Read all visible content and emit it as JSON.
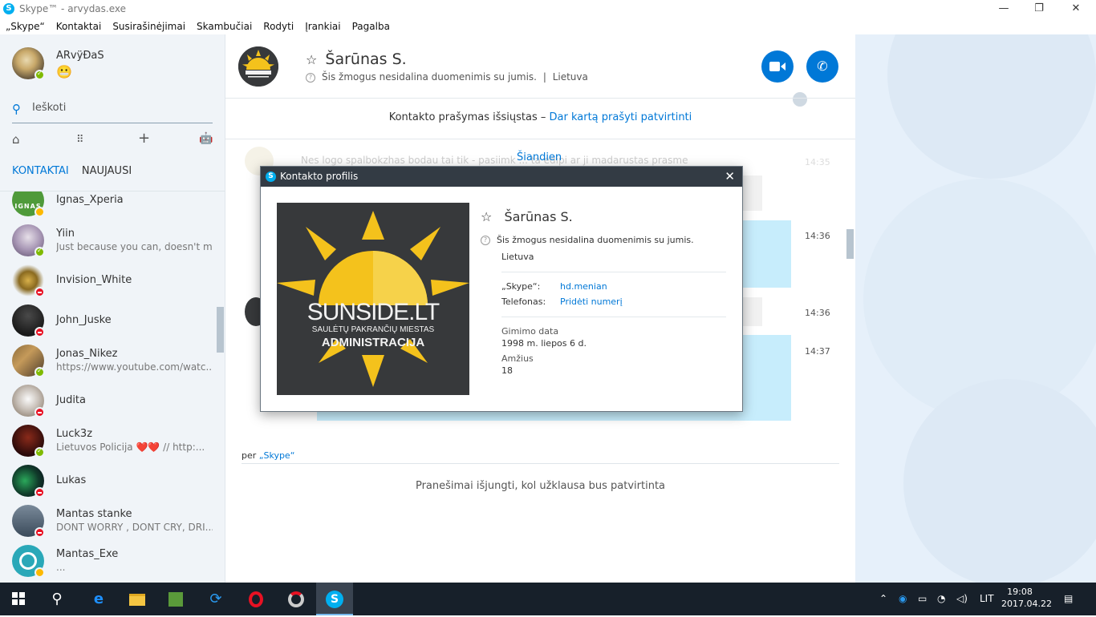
{
  "window": {
    "title": "Skype™ - arvydas.exe",
    "min": "—",
    "restore": "❐",
    "close": "✕"
  },
  "menu": [
    "„Skype“",
    "Kontaktai",
    "Susirašinėjimai",
    "Skambučiai",
    "Rodyti",
    "Įrankiai",
    "Pagalba"
  ],
  "me": {
    "name": "ARvÿÐaS",
    "mood": "😬"
  },
  "search": {
    "placeholder": "Ieškoti"
  },
  "sidebar_tools": {
    "home": "⌂",
    "dialpad": "⠿",
    "add": "+",
    "bot": "🤖"
  },
  "tabs": {
    "contacts": "KONTAKTAI",
    "recent": "NAUJAUSI"
  },
  "contacts": [
    {
      "name": "Ignas_Xperia",
      "message": "",
      "status": "away"
    },
    {
      "name": "Yiin",
      "message": "Just because you can, doesn't me...",
      "status": "online"
    },
    {
      "name": "Invision_White",
      "message": "",
      "status": "dnd"
    },
    {
      "name": "John_Juske",
      "message": "",
      "status": "dnd"
    },
    {
      "name": "Jonas_Nikez",
      "message": "https://www.youtube.com/watc...",
      "status": "online"
    },
    {
      "name": "Judita",
      "message": "",
      "status": "dnd"
    },
    {
      "name": "Luck3z",
      "message": "Lietuvos Policija ❤️❤️ // http:...",
      "status": "online"
    },
    {
      "name": "Lukas",
      "message": "",
      "status": "dnd"
    },
    {
      "name": "Mantas stanke",
      "message": "DONT WORRY , DONT CRY, DRI...",
      "status": "dnd"
    },
    {
      "name": "Mantas_Exe",
      "message": "...",
      "status": "away"
    }
  ],
  "avatar_labels": {
    "ignas": "IGNAS"
  },
  "chat": {
    "contact_name": "Šarūnas S.",
    "subtitle": "Šis žmogus nesidalina duomenimis su jumis.",
    "location_sep": "|",
    "location": "Lietuva",
    "request_text": "Kontakto prašymas išsiųstas –",
    "request_link": "Dar kartą prašyti patvirtinti",
    "today": "Šiandien",
    "times": [
      "14:35",
      "14:36",
      "14:36",
      "14:37"
    ],
    "via_label": "per",
    "via_link": "„Skype“",
    "notice": "Pranešimai išjungti, kol užklausa bus patvirtinta",
    "faded_message": "Nes logo spalbokzhas bodau tai tik - pasiimk ... ta edipi ar ji madarustas prasme"
  },
  "logo": {
    "brand": "SUNSIDE.LT",
    "line1": "SAULĖTŲ PAKRANČIŲ MIESTAS",
    "line2": "ADMINISTRACIJA"
  },
  "dialog": {
    "title": "Kontakto profilis",
    "close": "✕",
    "name": "Šarūnas S.",
    "subtitle": "Šis žmogus nesidalina duomenimis su jumis.",
    "location": "Lietuva",
    "skype_label": "„Skype“:",
    "skype_value": "hd.menian",
    "phone_label": "Telefonas:",
    "phone_value": "Pridėti numerį",
    "birth_label": "Gimimo data",
    "birth_value": "1998 m. liepos 6 d.",
    "age_label": "Amžius",
    "age_value": "18"
  },
  "taskbar": {
    "lang": "LIT",
    "time": "19:08",
    "date": "2017.04.22"
  },
  "colors": {
    "accent": "#0078d7",
    "skype": "#00aff0",
    "online": "#7fba00",
    "dnd": "#e81123",
    "away": "#fdb900",
    "bubble": "#c7edfc"
  }
}
